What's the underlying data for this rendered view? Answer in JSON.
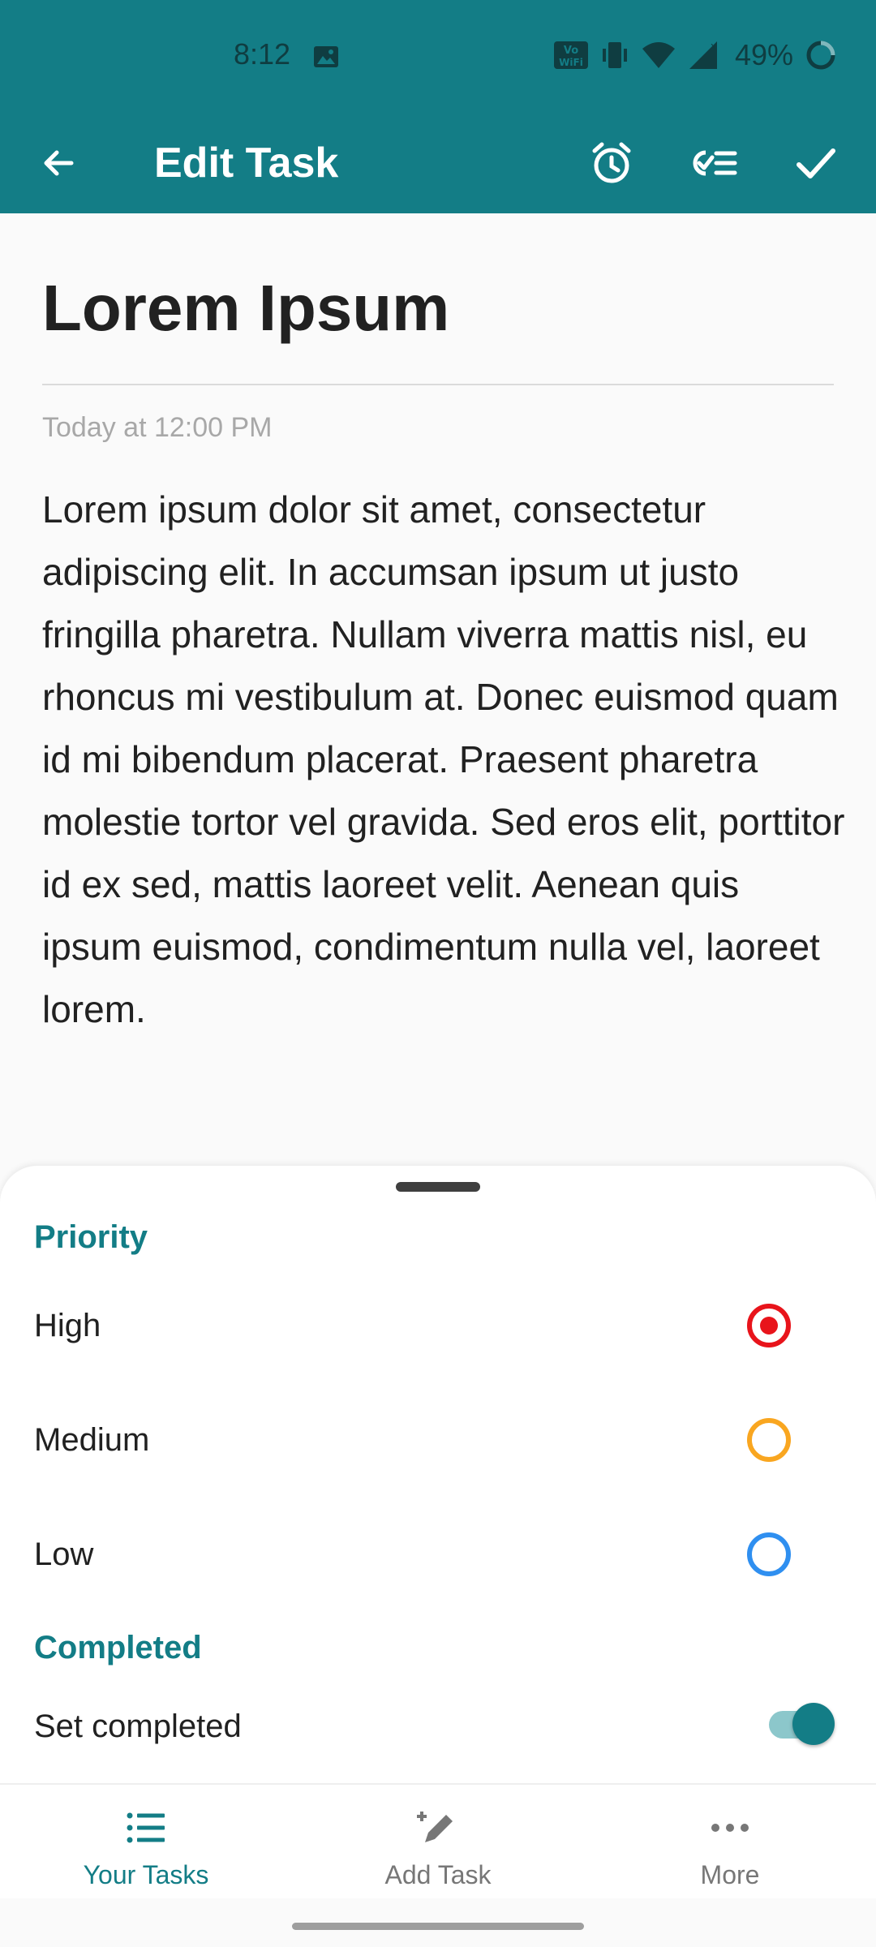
{
  "status_bar": {
    "time": "8:12",
    "battery_text": "49%",
    "icons": [
      "image-icon",
      "vowifi-icon",
      "vibrate-icon",
      "wifi-icon",
      "signal-icon",
      "battery-icon"
    ]
  },
  "app_bar": {
    "title": "Edit Task",
    "back_icon": "arrow-back-icon",
    "actions": [
      "alarm-icon",
      "checklist-icon",
      "check-icon"
    ]
  },
  "task": {
    "title": "Lorem Ipsum",
    "date": "Today at 12:00 PM",
    "description": "Lorem ipsum dolor sit amet, consectetur adipiscing elit. In accumsan ipsum ut justo fringilla pharetra. Nullam viverra mattis nisl, eu rhoncus mi vestibulum at. Donec euismod quam id mi bibendum placerat. Praesent pharetra molestie tortor vel gravida. Sed eros elit, porttitor id ex sed, mattis laoreet velit. Aenean quis ipsum euismod, condimentum nulla vel, laoreet lorem."
  },
  "sheet": {
    "priority_header": "Priority",
    "priorities": [
      {
        "label": "High",
        "color": "#E8141B",
        "selected": true
      },
      {
        "label": "Medium",
        "color": "#F9A620",
        "selected": false
      },
      {
        "label": "Low",
        "color": "#2F8FF0",
        "selected": false
      }
    ],
    "completed_header": "Completed",
    "completed_label": "Set completed",
    "completed_on": true
  },
  "bottom_nav": {
    "items": [
      {
        "label": "Your Tasks",
        "icon": "list-icon",
        "active": true
      },
      {
        "label": "Add Task",
        "icon": "edit-pen-icon",
        "active": false
      },
      {
        "label": "More",
        "icon": "more-horizontal-icon",
        "active": false
      }
    ]
  },
  "colors": {
    "primary": "#137D86",
    "text": "#212121",
    "muted": "#A8A8A8"
  }
}
